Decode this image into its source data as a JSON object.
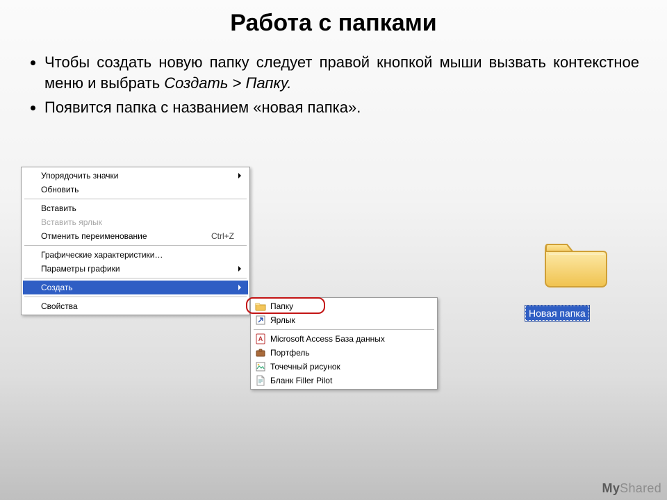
{
  "title": "Работа с папками",
  "bullets": {
    "b1_pre": "Чтобы создать новую папку следует правой кнопкой мыши вызвать контекстное меню и выбрать ",
    "b1_italic": "Создать > Папку.",
    "b2": "Появится папка с названием «новая папка»."
  },
  "main_menu": {
    "arrange": "Упорядочить значки",
    "refresh": "Обновить",
    "paste": "Вставить",
    "paste_shortcut": "Вставить ярлык",
    "undo": "Отменить переименование",
    "undo_key": "Ctrl+Z",
    "graph_char": "Графические характеристики…",
    "graph_param": "Параметры графики",
    "create": "Создать",
    "properties": "Свойства"
  },
  "sub_menu": {
    "folder": "Папку",
    "shortcut": "Ярлык",
    "access": "Microsoft Access База данных",
    "briefcase": "Портфель",
    "bitmap": "Точечный рисунок",
    "fillerpilot": "Бланк Filler Pilot"
  },
  "folder_label": "Новая папка",
  "watermark_left": "My",
  "watermark_right": "Shared"
}
